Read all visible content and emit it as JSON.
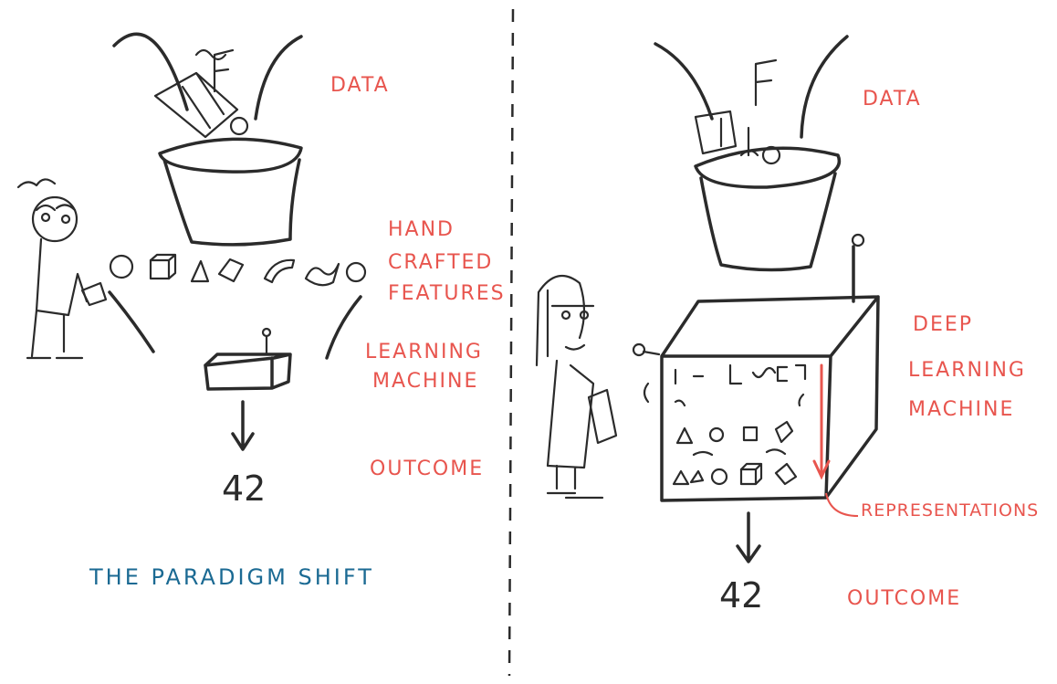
{
  "colors": {
    "label": "#e8554e",
    "title": "#1b6a93",
    "ink": "#2b2b2b"
  },
  "left": {
    "data_label": "DATA",
    "features_label": [
      "HAND",
      "CRAFTED",
      "FEATURES"
    ],
    "machine_label": [
      "LEARNING",
      "MACHINE"
    ],
    "outcome_label": "OUTCOME",
    "outcome_value": "42"
  },
  "title": "THE PARADIGM SHIFT",
  "right": {
    "data_label": "DATA",
    "machine_label": [
      "DEEP",
      "LEARNING",
      "MACHINE"
    ],
    "representations_label": "REPRESENTATIONS",
    "outcome_label": "OUTCOME",
    "outcome_value": "42"
  }
}
